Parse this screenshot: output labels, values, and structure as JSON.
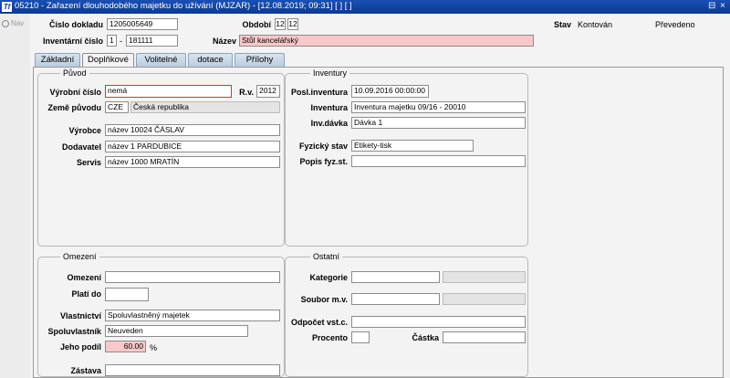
{
  "window": {
    "title": "05210 - Zařazení dlouhodobého majetku do užívání (MJZAR) - [12.08.2019; 09:31]  [ ]  [ ]",
    "icon_text": "Tf",
    "restore_symbol": "⊟",
    "close_symbol": "×"
  },
  "nav": {
    "label": "Nav"
  },
  "header": {
    "cislo_dokladu_label": "Číslo dokladu",
    "cislo_dokladu_value": "1205005649",
    "obdobi_label": "Období",
    "obdobi_a": "12",
    "obdobi_b": "12",
    "inventarni_cislo_label": "Inventární číslo",
    "inv_cislo_a": "1",
    "inv_cislo_sep": "-",
    "inv_cislo_b": "181111",
    "nazev_label": "Název",
    "nazev_value": "Stůl kancelářský",
    "stav_label": "Stav",
    "stav_value": "Kontován",
    "stav_extra": "Převedeno"
  },
  "tabs": [
    {
      "label": "Základní"
    },
    {
      "label": "Doplňkové"
    },
    {
      "label": "Volitelné"
    },
    {
      "label": "dotace"
    },
    {
      "label": "Přílohy"
    }
  ],
  "puvod": {
    "title": "Původ",
    "vyrobni_cislo_label": "Výrobní číslo",
    "vyrobni_cislo_value": "nemá",
    "rv_label": "R.v.",
    "rv_value": "2012",
    "zeme_puvodu_label": "Země původu",
    "zeme_code": "CZE",
    "zeme_name": "Česká republika",
    "vyrobce_label": "Výrobce",
    "vyrobce_value": "název 10024  ČÁSLAV",
    "dodavatel_label": "Dodavatel",
    "dodavatel_value": "název 1  PARDUBICE",
    "servis_label": "Servis",
    "servis_value": "název 1000  MRATÍN"
  },
  "inventury": {
    "title": "Inventury",
    "posl_label": "Posl.inventura",
    "posl_value": "10.09.2016 00:00:00",
    "inventura_label": "Inventura",
    "inventura_value": "Inventura majetku 09/16 - 20010",
    "invdavka_label": "Inv.dávka",
    "invdavka_value": "Dávka 1",
    "fyzicky_stav_label": "Fyzický stav",
    "fyzicky_stav_value": "Etikety-tisk",
    "popis_label": "Popis fyz.st.",
    "popis_value": ""
  },
  "omezeni": {
    "title": "Omezení",
    "omezeni_label": "Omezení",
    "omezeni_value": "",
    "plati_do_label": "Platí do",
    "plati_do_value": "",
    "vlastnictvi_label": "Vlastnictví",
    "vlastnictvi_value": "Spoluvlastněný majetek",
    "spoluvlastnik_label": "Spoluvlastník",
    "spoluvlastnik_value": "Neuveden",
    "jeho_podil_label": "Jeho podíl",
    "jeho_podil_value": "60.00",
    "jeho_podil_unit": "%",
    "zastava_label": "Zástava",
    "zastava_value": ""
  },
  "ostatni": {
    "title": "Ostatní",
    "kategorie_label": "Kategorie",
    "kategorie_value": "",
    "soubor_label": "Soubor m.v.",
    "soubor_value": "",
    "odpocet_label": "Odpočet vst.c.",
    "odpocet_value": "",
    "procento_label": "Procento",
    "procento_value": "",
    "castka_label": "Částka",
    "castka_value": ""
  },
  "colors": {
    "titlebar": "#1b4fb3",
    "required_field": "#f9c8c8",
    "error_border": "#e03030",
    "tab_inactive": "#c7d6e6"
  }
}
